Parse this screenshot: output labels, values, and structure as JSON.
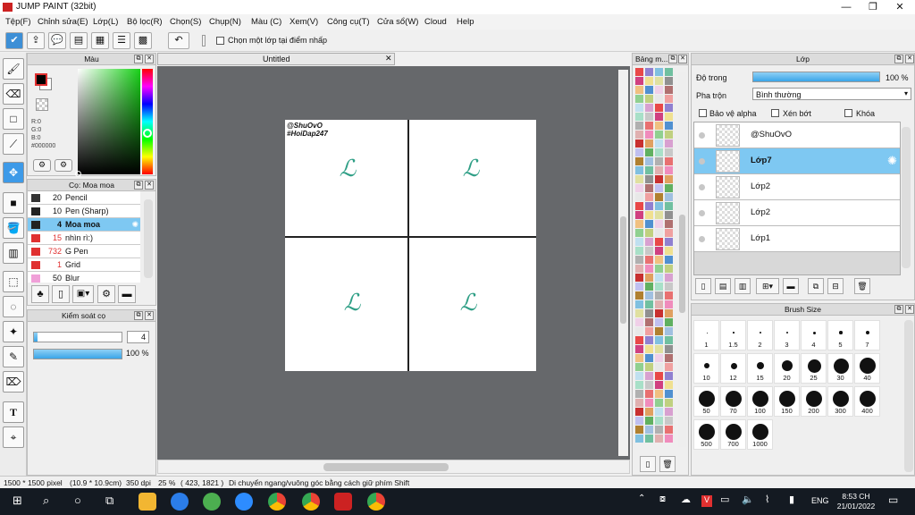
{
  "window": {
    "title": "JUMP PAINT (32bit)"
  },
  "menu": [
    "Tệp(F)",
    "Chỉnh sửa(E)",
    "Lớp(L)",
    "Bộ lọc(R)",
    "Chọn(S)",
    "Chụp(N)",
    "Màu (C)",
    "Xem(V)",
    "Công cụ(T)",
    "Cửa sổ(W)",
    "Cloud",
    "Help"
  ],
  "toolbar": {
    "checkbox_label": "Chọn một lớp tại điểm nhấp"
  },
  "color_panel": {
    "title": "Màu",
    "r": "R:0",
    "g": "G:0",
    "b": "B:0",
    "hex": "#000000",
    "fg_color": "#000000"
  },
  "brush_panel": {
    "title": "Cọ: Moa moa",
    "items": [
      {
        "size": "20",
        "name": "Pencil",
        "color": "#333333"
      },
      {
        "size": "10",
        "name": "Pen (Sharp)",
        "color": "#222222"
      },
      {
        "size": "4",
        "name": "Moa moa",
        "color": "#222222"
      },
      {
        "size": "15",
        "name": "nhìn rì:)",
        "color": "#e03030"
      },
      {
        "size": "732",
        "name": "G Pen",
        "color": "#e03030"
      },
      {
        "size": "1",
        "name": "Grid",
        "color": "#e03030"
      },
      {
        "size": "50",
        "name": "Blur",
        "color": "#f0a0d8"
      }
    ]
  },
  "brush_control": {
    "title": "Kiểm soát cọ",
    "size_value": "4",
    "opacity_value": "100 %",
    "opacity_fraction": 1.0,
    "size_fraction": 0.04
  },
  "document": {
    "tab": "Untitled",
    "watermark_line1": "@ShuOvO",
    "watermark_line2": "#HoiDap247",
    "glyph": "ℒ"
  },
  "palette_panel": {
    "title": "Bảng m..."
  },
  "layer_panel": {
    "title": "Lớp",
    "opacity_label": "Độ trong",
    "opacity_value": "100 %",
    "blend_label": "Pha trộn",
    "blend_value": "Bình thường",
    "protect_alpha": "Bảo vệ alpha",
    "clipping": "Xén bớt",
    "lock": "Khóa",
    "layers": [
      {
        "name": "@ShuOvO",
        "selected": false
      },
      {
        "name": "Lớp7",
        "selected": true
      },
      {
        "name": "Lớp2",
        "selected": false
      },
      {
        "name": "Lớp2",
        "selected": false
      },
      {
        "name": "Lớp1",
        "selected": false
      }
    ]
  },
  "brush_size_panel": {
    "title": "Brush Size",
    "sizes": [
      "1",
      "1.5",
      "2",
      "3",
      "4",
      "5",
      "7",
      "10",
      "12",
      "15",
      "20",
      "25",
      "30",
      "40",
      "50",
      "70",
      "100",
      "150",
      "200",
      "300",
      "400",
      "500",
      "700",
      "1000"
    ]
  },
  "status": {
    "dims": "1500 * 1500 pixel",
    "cm": "(10.9 * 10.9cm)",
    "dpi": "350 dpi",
    "zoom": "25 %",
    "coords": "( 423, 1821 )",
    "hint": "Di chuyển ngang/vuông góc bằng cách giữ phím Shift"
  },
  "taskbar": {
    "lang": "ENG",
    "time": "8:53 CH",
    "date": "21/01/2022"
  }
}
